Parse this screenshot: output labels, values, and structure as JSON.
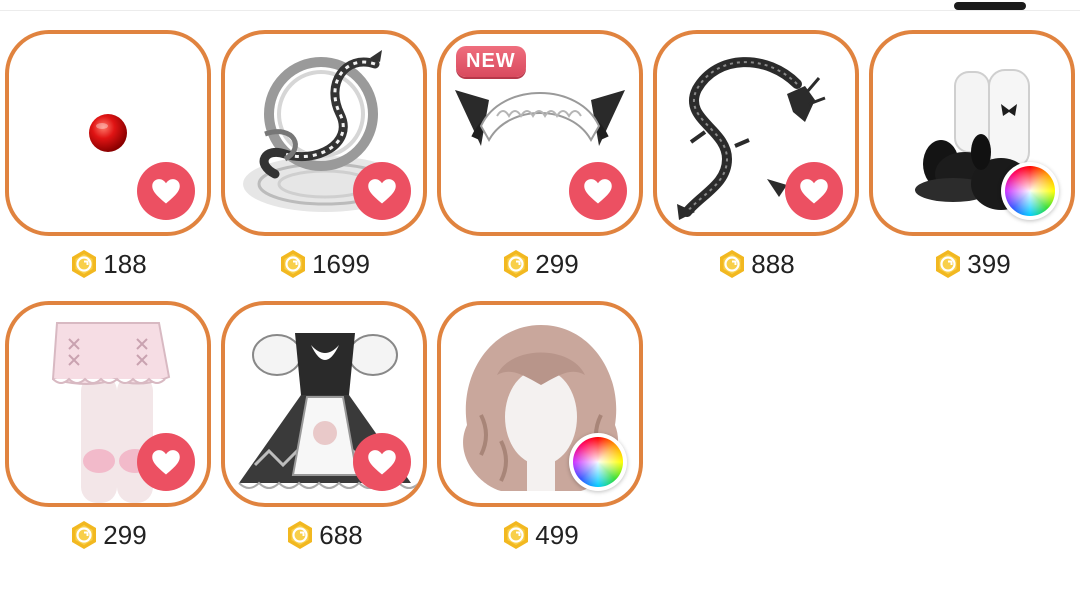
{
  "colors": {
    "card_border": "#e0833f",
    "favorite": "#ec5062",
    "badge": "#e05a6c",
    "coin": "#f2b820"
  },
  "currency_icon": "gold-coin-icon",
  "items": [
    {
      "name": "red-nose",
      "price": "188",
      "action": "favorite"
    },
    {
      "name": "silver-dragon-halo",
      "price": "1699",
      "action": "favorite"
    },
    {
      "name": "maid-cat-ears-headband",
      "price": "299",
      "action": "favorite",
      "badge": "NEW"
    },
    {
      "name": "black-dragon",
      "price": "888",
      "action": "favorite"
    },
    {
      "name": "bunny-shoes-socks",
      "price": "399",
      "action": "color"
    },
    {
      "name": "pink-bloomers-legs",
      "price": "299",
      "action": "favorite"
    },
    {
      "name": "maid-lolita-dress",
      "price": "688",
      "action": "favorite"
    },
    {
      "name": "wavy-pink-hair",
      "price": "499",
      "action": "color"
    }
  ]
}
